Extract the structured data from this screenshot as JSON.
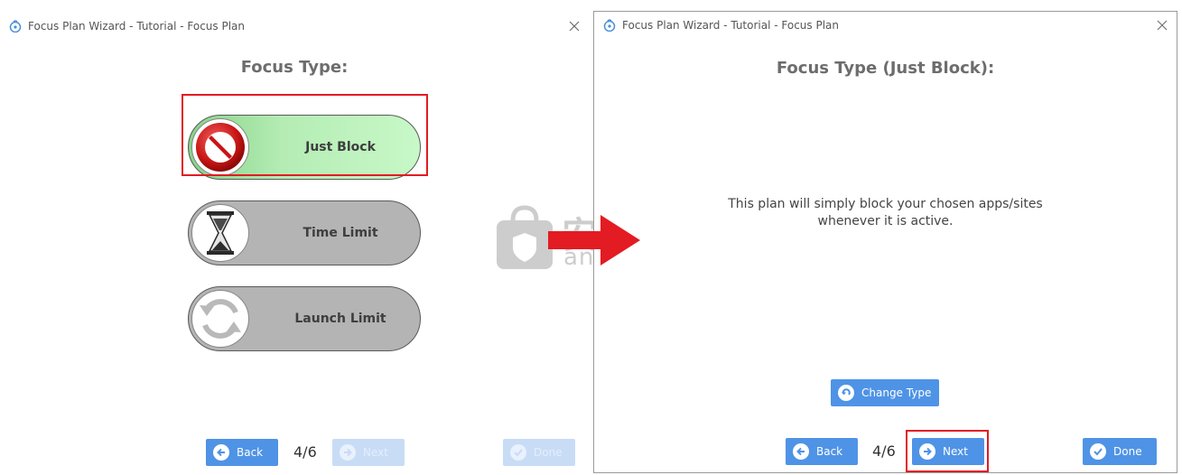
{
  "left_window": {
    "title": "Focus Plan Wizard - Tutorial - Focus Plan",
    "heading": "Focus Type:",
    "options": [
      {
        "label": "Just Block",
        "icon": "no-entry-icon",
        "state": "selected"
      },
      {
        "label": "Time Limit",
        "icon": "hourglass-icon",
        "state": "unselected"
      },
      {
        "label": "Launch Limit",
        "icon": "refresh-icon",
        "state": "unselected"
      }
    ],
    "back_label": "Back",
    "page_indicator": "4/6",
    "next_label": "Next",
    "done_label": "Done"
  },
  "right_window": {
    "title": "Focus Plan Wizard - Tutorial - Focus Plan",
    "heading": "Focus Type (Just Block):",
    "description": "This plan will simply block your chosen apps/sites whenever it is active.",
    "change_type_label": "Change Type",
    "back_label": "Back",
    "page_indicator": "4/6",
    "next_label": "Next",
    "done_label": "Done"
  },
  "watermark": {
    "text": "安下载",
    "url": "anxz.com"
  },
  "colors": {
    "button_blue": "#4f93e6",
    "button_disabled": "#c8dcf6",
    "highlight_red": "#e31b23",
    "selected_green": "#b4ecb4",
    "unselected_gray": "#b4b4b4",
    "heading_gray": "#6d6d6d"
  }
}
